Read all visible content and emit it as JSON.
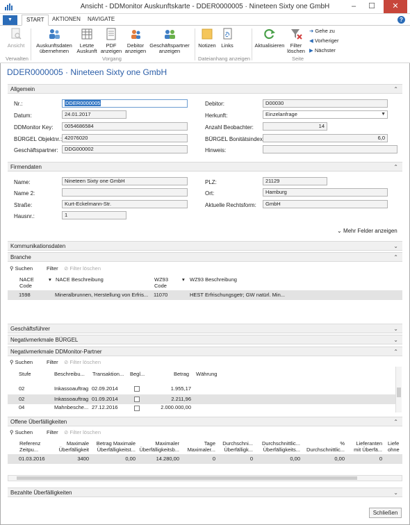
{
  "window": {
    "title": "Ansicht - DDMonitor Auskunftskarte - DDER0000005 · Nineteen Sixty one GmbH",
    "controls": {
      "minimize": "–",
      "maximize": "☐",
      "close": "✕"
    }
  },
  "ribbon": {
    "tabs": {
      "file": "▼",
      "start": "START",
      "aktionen": "AKTIONEN",
      "navigate": "NAVIGATE"
    },
    "buttons": {
      "ansicht": "Ansicht",
      "auskunftsdaten": "Auskunftsdaten übernehmen",
      "letzte": "Letzte Auskunft",
      "pdf": "PDF anzeigen",
      "debitor": "Debitor anzeigen",
      "geschaeftspartner": "Geschäftspartner anzeigen",
      "notizen": "Notizen",
      "links": "Links",
      "aktualisieren": "Aktualisieren",
      "filter_loeschen": "Filter löschen",
      "gehe_zu": "Gehe zu",
      "vorheriger": "Vorheriger",
      "naechster": "Nächster"
    },
    "groups": {
      "verwalten": "Verwalten",
      "vorgang": "Vorgang",
      "dateianhang": "Dateianhang anzeigen",
      "seite": "Seite"
    }
  },
  "page": {
    "heading": "DDER0000005 · Nineteen Sixty one GmbH"
  },
  "allgemein": {
    "title": "Allgemein",
    "nr_label": "Nr.:",
    "nr": "DDER0000005",
    "datum_label": "Datum:",
    "datum": "24.01.2017",
    "key_label": "DDMonitor Key:",
    "key": "0054686584",
    "objekt_label": "BÜRGEL Objektnr.:",
    "objekt": "42076020",
    "partner_label": "Geschäftspartner:",
    "partner": "DDG000002",
    "debitor_label": "Debitor:",
    "debitor": "D00030",
    "herkunft_label": "Herkunft:",
    "herkunft": "Einzelanfrage",
    "beobachter_label": "Anzahl Beobachter:",
    "beobachter": "14",
    "bonitaet_label": "BÜRGEL Bonitätsindex:",
    "bonitaet": "6,0",
    "hinweis_label": "Hinweis:",
    "hinweis": ""
  },
  "firmendaten": {
    "title": "Firmendaten",
    "name_label": "Name:",
    "name": "Nineteen Sixty one GmbH",
    "name2_label": "Name 2:",
    "name2": "",
    "strasse_label": "Straße:",
    "strasse": "Kurt-Eckelmann-Str.",
    "hausnr_label": "Hausnr.:",
    "hausnr": "1",
    "plz_label": "PLZ:",
    "plz": "21129",
    "ort_label": "Ort:",
    "ort": "Hamburg",
    "rechtsform_label": "Aktuelle Rechtsform:",
    "rechtsform": "GmbH",
    "more": "Mehr Felder anzeigen"
  },
  "kommunikation": {
    "title": "Kommunikationsdaten"
  },
  "branche": {
    "title": "Branche",
    "toolbar": {
      "suchen": "Suchen",
      "filter": "Filter",
      "filter_loeschen": "Filter löschen"
    },
    "columns": [
      "NACE Code",
      "NACE Beschreibung",
      "WZ93 Code",
      "WZ93 Beschreibung"
    ],
    "rows": [
      {
        "nace": "1598",
        "beschreibung": "Mineralbrunnen, Herstellung von Erfris...",
        "wz": "11070",
        "wzbeschreibung": "HEST Erfrischungsgetr; GW natürl. Min..."
      }
    ]
  },
  "geschaeftsfuehrer": {
    "title": "Geschäftsführer"
  },
  "negativ_buergel": {
    "title": "Negativmerkmale BÜRGEL"
  },
  "negativ_dd": {
    "title": "Negativmerkmale DDMonitor-Partner",
    "toolbar": {
      "suchen": "Suchen",
      "filter": "Filter",
      "filter_loeschen": "Filter löschen"
    },
    "columns": [
      "Stufe",
      "Beschreibu...",
      "Transaktion...",
      "Begl...",
      "Betrag",
      "Währung"
    ],
    "rows": [
      {
        "stufe": "02",
        "beschreibung": "Inkassoauftrag",
        "datum": "02.09.2014",
        "betrag": "1.955,17"
      },
      {
        "stufe": "02",
        "beschreibung": "Inkassoauftrag",
        "datum": "01.09.2014",
        "betrag": "2.211,96"
      },
      {
        "stufe": "04",
        "beschreibung": "Mahnbesche...",
        "datum": "27.12.2016",
        "betrag": "2.000.000,00"
      }
    ]
  },
  "offene": {
    "title": "Offene Überfälligkeiten",
    "toolbar": {
      "suchen": "Suchen",
      "filter": "Filter",
      "filter_loeschen": "Filter löschen"
    },
    "columns": [
      "Referenz Zeitpu...",
      "Maximale Überfälligkeit",
      "Betrag Maximale Überfälligkeitst...",
      "Maximaler Überfälligkeitsb...",
      "Tage Maximaler...",
      "Durchschni... Überfälligk...",
      "Durchschnittlic... Überfälligkeits...",
      "% Durchschnittlic...",
      "Lieferanten mit Überfä...",
      "Liefe ohne"
    ],
    "rows": [
      {
        "c0": "01.03.2016",
        "c1": "3400",
        "c2": "0,00",
        "c3": "14.280,00",
        "c4": "0",
        "c5": "0",
        "c6": "0,00",
        "c7": "0,00",
        "c8": "0",
        "c9": ""
      }
    ]
  },
  "bezahlte": {
    "title": "Bezahlte Überfälligkeiten"
  },
  "footer": {
    "close": "Schließen"
  }
}
